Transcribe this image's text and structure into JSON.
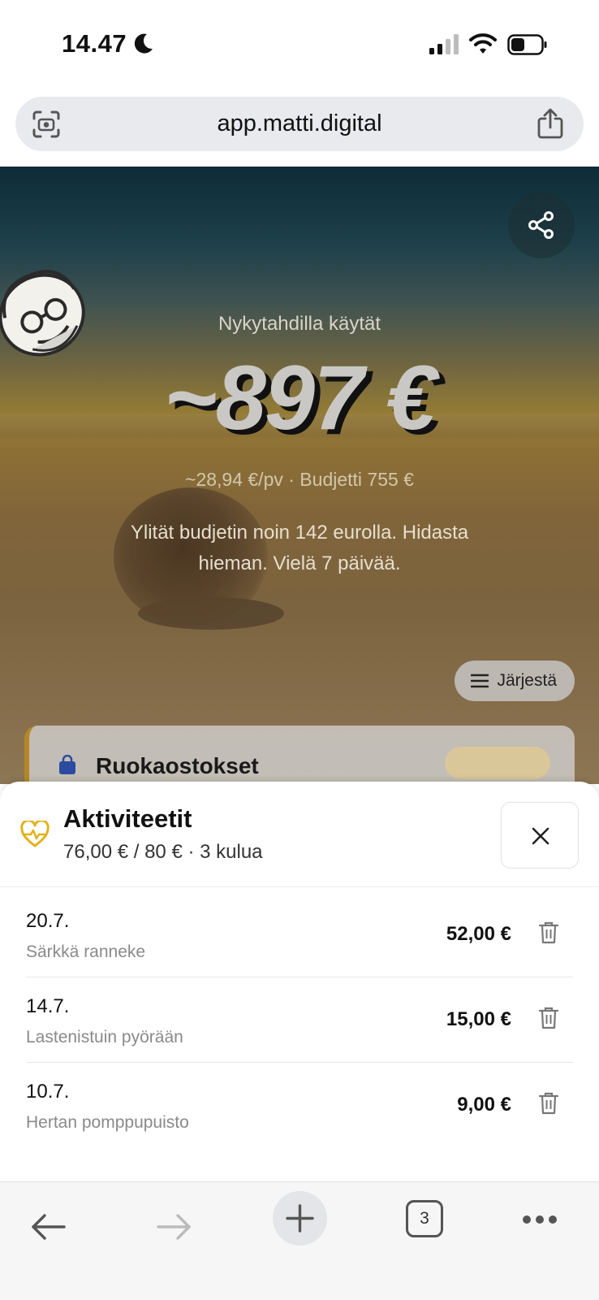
{
  "status": {
    "time": "14.47",
    "moon_icon": "moon-icon",
    "signal_icon": "signal-icon",
    "wifi_icon": "wifi-icon",
    "battery_icon": "battery-icon"
  },
  "browser": {
    "url": "app.matti.digital",
    "tab_count": "3"
  },
  "hero": {
    "subtitle": "Nykytahdilla käytät",
    "amount": "~897 €",
    "rate": "~28,94 €/pv · Budjetti 755 €",
    "message": "Ylität budjetin noin 142 eurolla. Hidasta hieman. Vielä 7 päivää.",
    "sort_label": "Järjestä",
    "peek_card_title": "Ruokaostokset"
  },
  "sheet": {
    "title": "Aktiviteetit",
    "summary": "76,00 € / 80 € · 3 kulua",
    "accent_color": "#e0b31e",
    "rows": [
      {
        "date": "20.7.",
        "description": "Särkkä ranneke",
        "amount": "52,00 €"
      },
      {
        "date": "14.7.",
        "description": "Lastenistuin pyörään",
        "amount": "15,00 €"
      },
      {
        "date": "10.7.",
        "description": "Hertan pomppupuisto",
        "amount": "9,00 €"
      }
    ]
  }
}
